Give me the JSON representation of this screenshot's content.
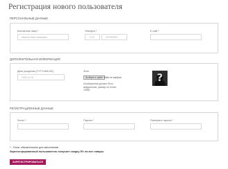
{
  "title": "Регистрация нового пользователя",
  "personal": {
    "heading": "Персональные данные",
    "name_label": "Контактное лицо *",
    "name_placeholder": "Иванов Иван Иванович",
    "phone_label": "Телефон *",
    "phone_code": "+375",
    "phone_placeholder": "297000000",
    "email_label": "E-mail *"
  },
  "extra": {
    "heading": "Дополнительная информация",
    "birth_label": "День рождения (YYYY-MM-DD)",
    "birth_placeholder": "1990-12-30",
    "photo_label": "Фото",
    "file_button": "Выберите файл",
    "file_none": "Файл не выбран",
    "hint": "Изображение должно быть квадратным, размер не более 150kb.",
    "avatar_icon": "question-mark-silhouette"
  },
  "account": {
    "heading": "Регистрационные данные",
    "login_label": "Логин *",
    "password_label": "Пароль *",
    "repeat_label": "Повторите пароль *"
  },
  "notes": {
    "required": "* - Поля, обязательные для заполнения",
    "discount": "Зарегистрированный пользователь получает скидку 5% на все товары"
  },
  "submit_label": "Зарегистрироваться",
  "colors": {
    "accent": "#a3195b",
    "border": "#d6d6d6"
  }
}
